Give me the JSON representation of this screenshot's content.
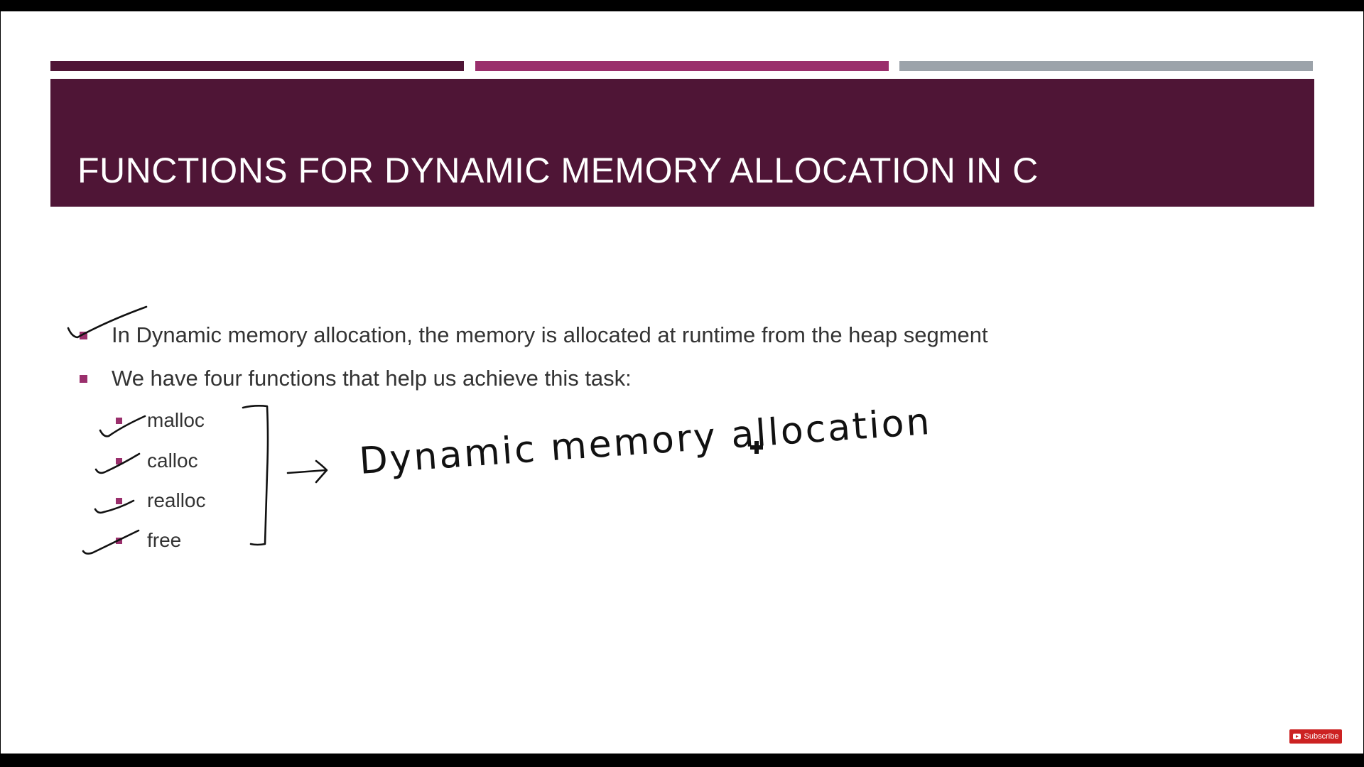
{
  "slide": {
    "title": "Functions for Dynamic Memory Allocation in C",
    "bullets": [
      "In Dynamic memory allocation, the memory is allocated at runtime from the heap segment",
      "We have four functions that help us achieve this task:"
    ],
    "functions": [
      "malloc",
      "calloc",
      "realloc",
      "free"
    ]
  },
  "annotation": {
    "handwritten_text": "Dynamic memory allocation"
  },
  "subscribe": {
    "label": "Subscribe"
  },
  "colors": {
    "title_band": "#4f1536",
    "accent_bar_1": "#4f1536",
    "accent_bar_2": "#9a2f6c",
    "accent_bar_3": "#9ca3aa",
    "bullet": "#9a2f6c",
    "ink": "#111111",
    "subscribe": "#cc2222"
  }
}
